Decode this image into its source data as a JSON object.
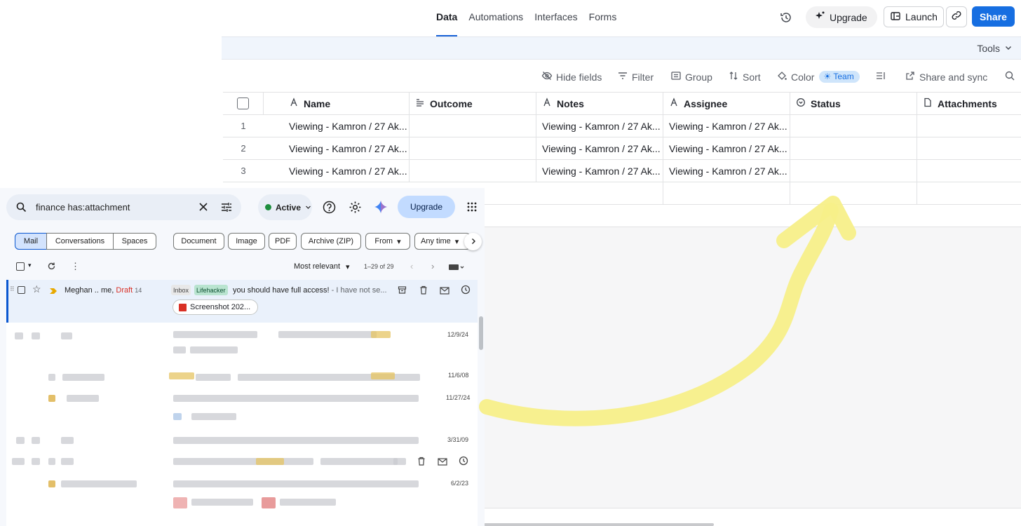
{
  "airtable": {
    "tabs": [
      "Data",
      "Automations",
      "Interfaces",
      "Forms"
    ],
    "upgrade_label": "Upgrade",
    "launch_label": "Launch",
    "share_label": "Share",
    "tools_label": "Tools",
    "viewbar": {
      "hide_fields": "Hide fields",
      "filter": "Filter",
      "group": "Group",
      "sort": "Sort",
      "color": "Color",
      "team": "Team",
      "share_sync": "Share and sync"
    },
    "columns": [
      "Name",
      "Outcome",
      "Notes",
      "Assignee",
      "Status",
      "Attachments"
    ],
    "rows": [
      {
        "num": "1",
        "name": "Viewing - Kamron / 27 Ak...",
        "outcome": "",
        "notes": "Viewing - Kamron / 27 Ak...",
        "assignee": "Viewing - Kamron / 27 Ak...",
        "status": "",
        "attachments": ""
      },
      {
        "num": "2",
        "name": "Viewing - Kamron / 27 Ak...",
        "outcome": "",
        "notes": "Viewing - Kamron / 27 Ak...",
        "assignee": "Viewing - Kamron / 27 Ak...",
        "status": "",
        "attachments": ""
      },
      {
        "num": "3",
        "name": "Viewing - Kamron / 27 Ak...",
        "outcome": "",
        "notes": "Viewing - Kamron / 27 Ak...",
        "assignee": "Viewing - Kamron / 27 Ak...",
        "status": "",
        "attachments": ""
      }
    ],
    "accent_color": "#166ee1"
  },
  "gmail": {
    "search_value": "finance has:attachment",
    "status_label": "Active",
    "upgrade_label": "Upgrade",
    "segments": [
      "Mail",
      "Conversations",
      "Spaces"
    ],
    "chips": [
      "Document",
      "Image",
      "PDF",
      "Archive (ZIP)",
      "From",
      "Any time"
    ],
    "sort_label": "Most relevant",
    "range_label": "1–29 of 29",
    "first_row": {
      "sender": "Meghan .. me,",
      "draft": "Draft",
      "count": "14",
      "label_inbox": "Inbox",
      "label_lifehacker": "Lifehacker",
      "subject": "you should have full access!",
      "snippet": " - I have not se...",
      "attachment": "Screenshot 202..."
    },
    "dates": [
      "12/9/24",
      "11/6/08",
      "11/27/24",
      "3/31/09",
      "6/2/23"
    ]
  },
  "annotation": {
    "color": "#f8f08a",
    "type": "arrow"
  }
}
